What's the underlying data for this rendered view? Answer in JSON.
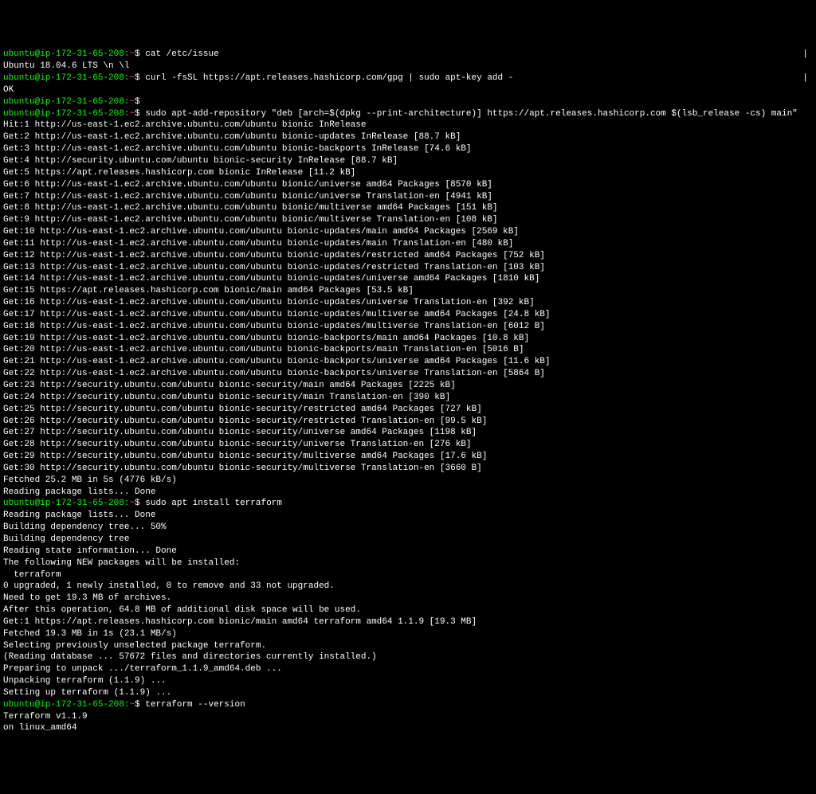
{
  "prompt_user_host": "ubuntu@ip-172-31-65-208",
  "prompt_path": ":~$",
  "prompt_suffix_char": "$",
  "commands": {
    "c1": "cat /etc/issue",
    "c2": "curl -fsSL https://apt.releases.hashicorp.com/gpg | sudo apt-key add -",
    "c3": "",
    "c4": "sudo apt-add-repository \"deb [arch=$(dpkg --print-architecture)] https://apt.releases.hashicorp.com $(lsb_release -cs) main\"",
    "c5": "sudo apt install terraform",
    "c6": "terraform --version"
  },
  "right_bar": "|",
  "output": {
    "issue": "Ubuntu 18.04.6 LTS \\n \\l",
    "blank": "",
    "ok": "OK",
    "apt_lines": [
      "Hit:1 http://us-east-1.ec2.archive.ubuntu.com/ubuntu bionic InRelease",
      "Get:2 http://us-east-1.ec2.archive.ubuntu.com/ubuntu bionic-updates InRelease [88.7 kB]",
      "Get:3 http://us-east-1.ec2.archive.ubuntu.com/ubuntu bionic-backports InRelease [74.6 kB]",
      "Get:4 http://security.ubuntu.com/ubuntu bionic-security InRelease [88.7 kB]",
      "Get:5 https://apt.releases.hashicorp.com bionic InRelease [11.2 kB]",
      "Get:6 http://us-east-1.ec2.archive.ubuntu.com/ubuntu bionic/universe amd64 Packages [8570 kB]",
      "Get:7 http://us-east-1.ec2.archive.ubuntu.com/ubuntu bionic/universe Translation-en [4941 kB]",
      "Get:8 http://us-east-1.ec2.archive.ubuntu.com/ubuntu bionic/multiverse amd64 Packages [151 kB]",
      "Get:9 http://us-east-1.ec2.archive.ubuntu.com/ubuntu bionic/multiverse Translation-en [108 kB]",
      "Get:10 http://us-east-1.ec2.archive.ubuntu.com/ubuntu bionic-updates/main amd64 Packages [2569 kB]",
      "Get:11 http://us-east-1.ec2.archive.ubuntu.com/ubuntu bionic-updates/main Translation-en [480 kB]",
      "Get:12 http://us-east-1.ec2.archive.ubuntu.com/ubuntu bionic-updates/restricted amd64 Packages [752 kB]",
      "Get:13 http://us-east-1.ec2.archive.ubuntu.com/ubuntu bionic-updates/restricted Translation-en [103 kB]",
      "Get:14 http://us-east-1.ec2.archive.ubuntu.com/ubuntu bionic-updates/universe amd64 Packages [1810 kB]",
      "Get:15 https://apt.releases.hashicorp.com bionic/main amd64 Packages [53.5 kB]",
      "Get:16 http://us-east-1.ec2.archive.ubuntu.com/ubuntu bionic-updates/universe Translation-en [392 kB]",
      "Get:17 http://us-east-1.ec2.archive.ubuntu.com/ubuntu bionic-updates/multiverse amd64 Packages [24.8 kB]",
      "Get:18 http://us-east-1.ec2.archive.ubuntu.com/ubuntu bionic-updates/multiverse Translation-en [6012 B]",
      "Get:19 http://us-east-1.ec2.archive.ubuntu.com/ubuntu bionic-backports/main amd64 Packages [10.8 kB]",
      "Get:20 http://us-east-1.ec2.archive.ubuntu.com/ubuntu bionic-backports/main Translation-en [5016 B]",
      "Get:21 http://us-east-1.ec2.archive.ubuntu.com/ubuntu bionic-backports/universe amd64 Packages [11.6 kB]",
      "Get:22 http://us-east-1.ec2.archive.ubuntu.com/ubuntu bionic-backports/universe Translation-en [5864 B]",
      "Get:23 http://security.ubuntu.com/ubuntu bionic-security/main amd64 Packages [2225 kB]",
      "Get:24 http://security.ubuntu.com/ubuntu bionic-security/main Translation-en [390 kB]",
      "Get:25 http://security.ubuntu.com/ubuntu bionic-security/restricted amd64 Packages [727 kB]",
      "Get:26 http://security.ubuntu.com/ubuntu bionic-security/restricted Translation-en [99.5 kB]",
      "Get:27 http://security.ubuntu.com/ubuntu bionic-security/universe amd64 Packages [1198 kB]",
      "Get:28 http://security.ubuntu.com/ubuntu bionic-security/universe Translation-en [276 kB]",
      "Get:29 http://security.ubuntu.com/ubuntu bionic-security/multiverse amd64 Packages [17.6 kB]",
      "Get:30 http://security.ubuntu.com/ubuntu bionic-security/multiverse Translation-en [3660 B]",
      "Fetched 25.2 MB in 5s (4776 kB/s)",
      "Reading package lists... Done"
    ],
    "install_lines": [
      "Reading package lists... Done",
      "Building dependency tree... 50%",
      "Building dependency tree       ",
      "Reading state information... Done",
      "The following NEW packages will be installed:",
      "  terraform",
      "0 upgraded, 1 newly installed, 0 to remove and 33 not upgraded.",
      "Need to get 19.3 MB of archives.",
      "After this operation, 64.8 MB of additional disk space will be used.",
      "Get:1 https://apt.releases.hashicorp.com bionic/main amd64 terraform amd64 1.1.9 [19.3 MB]",
      "Fetched 19.3 MB in 1s (23.1 MB/s)",
      "Selecting previously unselected package terraform.",
      "(Reading database ... 57672 files and directories currently installed.)",
      "Preparing to unpack .../terraform_1.1.9_amd64.deb ...",
      "Unpacking terraform (1.1.9) ...",
      "Setting up terraform (1.1.9) ..."
    ],
    "version_lines": [
      "Terraform v1.1.9",
      "on linux_amd64"
    ]
  }
}
